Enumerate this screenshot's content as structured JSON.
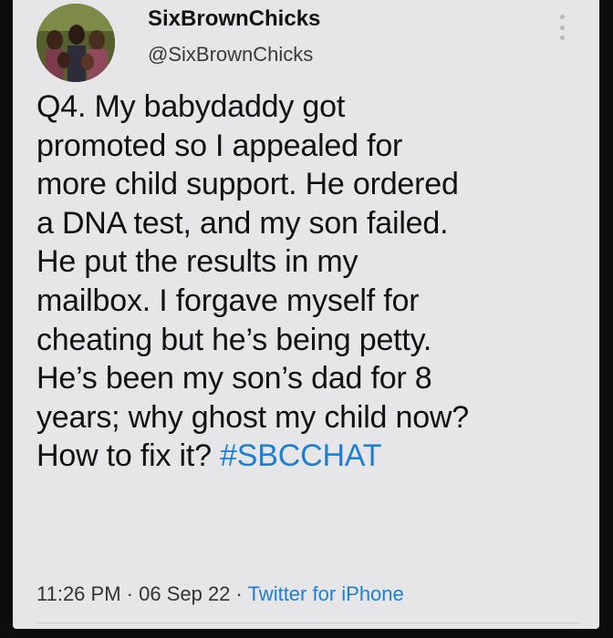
{
  "user": {
    "display_name": "SixBrownChicks",
    "handle": "@SixBrownChicks"
  },
  "tweet": {
    "lines": [
      "Q4. My babydaddy got",
      "promoted so I appealed for",
      "more child support. He ordered",
      "a DNA test, and my son failed.",
      "He put the results in my",
      "mailbox. I forgave myself for",
      "cheating but he’s being petty.",
      "He’s been my son’s dad for 8",
      "years; why ghost my child now?",
      "How to fix it?"
    ],
    "hashtag": "#SBCCHAT"
  },
  "meta": {
    "time": "11:26 PM",
    "separator": " · ",
    "date": "06 Sep 22",
    "source": "Twitter for iPhone"
  },
  "colors": {
    "card_background": "#e6e6e8",
    "link": "#1d7fd2",
    "text": "#111111"
  },
  "icons": {
    "more": "more-vertical-icon",
    "avatar": "profile-photo"
  }
}
